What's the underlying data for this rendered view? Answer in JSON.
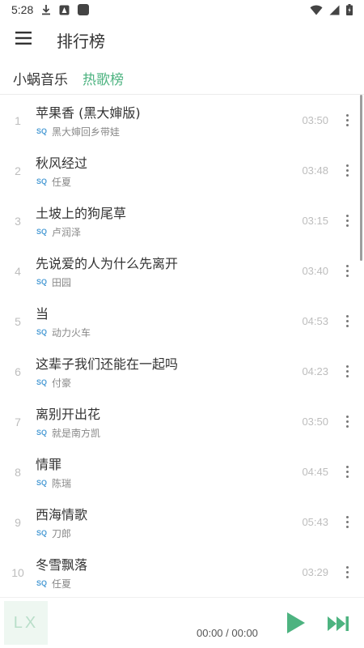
{
  "status_bar": {
    "time": "5:28"
  },
  "header": {
    "title": "排行榜",
    "menu_icon": "hamburger-menu-icon"
  },
  "source_tabs": [
    {
      "label": "小蜗音乐",
      "active": false
    },
    {
      "label": "热歌榜",
      "active": true
    }
  ],
  "songs": [
    {
      "index": "1",
      "title": "苹果香 (黑大婶版)",
      "quality": "SQ",
      "artist": "黑大婶回乡带娃",
      "duration": "03:50"
    },
    {
      "index": "2",
      "title": "秋风经过",
      "quality": "SQ",
      "artist": "任夏",
      "duration": "03:48"
    },
    {
      "index": "3",
      "title": "土坡上的狗尾草",
      "quality": "SQ",
      "artist": "卢润泽",
      "duration": "03:15"
    },
    {
      "index": "4",
      "title": "先说爱的人为什么先离开",
      "quality": "SQ",
      "artist": "田园",
      "duration": "03:40"
    },
    {
      "index": "5",
      "title": "当",
      "quality": "SQ",
      "artist": "动力火车",
      "duration": "04:53"
    },
    {
      "index": "6",
      "title": "这辈子我们还能在一起吗",
      "quality": "SQ",
      "artist": "付豪",
      "duration": "04:23"
    },
    {
      "index": "7",
      "title": "离别开出花",
      "quality": "SQ",
      "artist": "就是南方凯",
      "duration": "03:50"
    },
    {
      "index": "8",
      "title": "情罪",
      "quality": "SQ",
      "artist": "陈瑞",
      "duration": "04:45"
    },
    {
      "index": "9",
      "title": "西海情歌",
      "quality": "SQ",
      "artist": "刀郎",
      "duration": "05:43"
    },
    {
      "index": "10",
      "title": "冬雪飘落",
      "quality": "SQ",
      "artist": "任夏",
      "duration": "03:29"
    }
  ],
  "player": {
    "logo": "LX",
    "time": "00:00 / 00:00",
    "accent_color": "#4db380"
  }
}
